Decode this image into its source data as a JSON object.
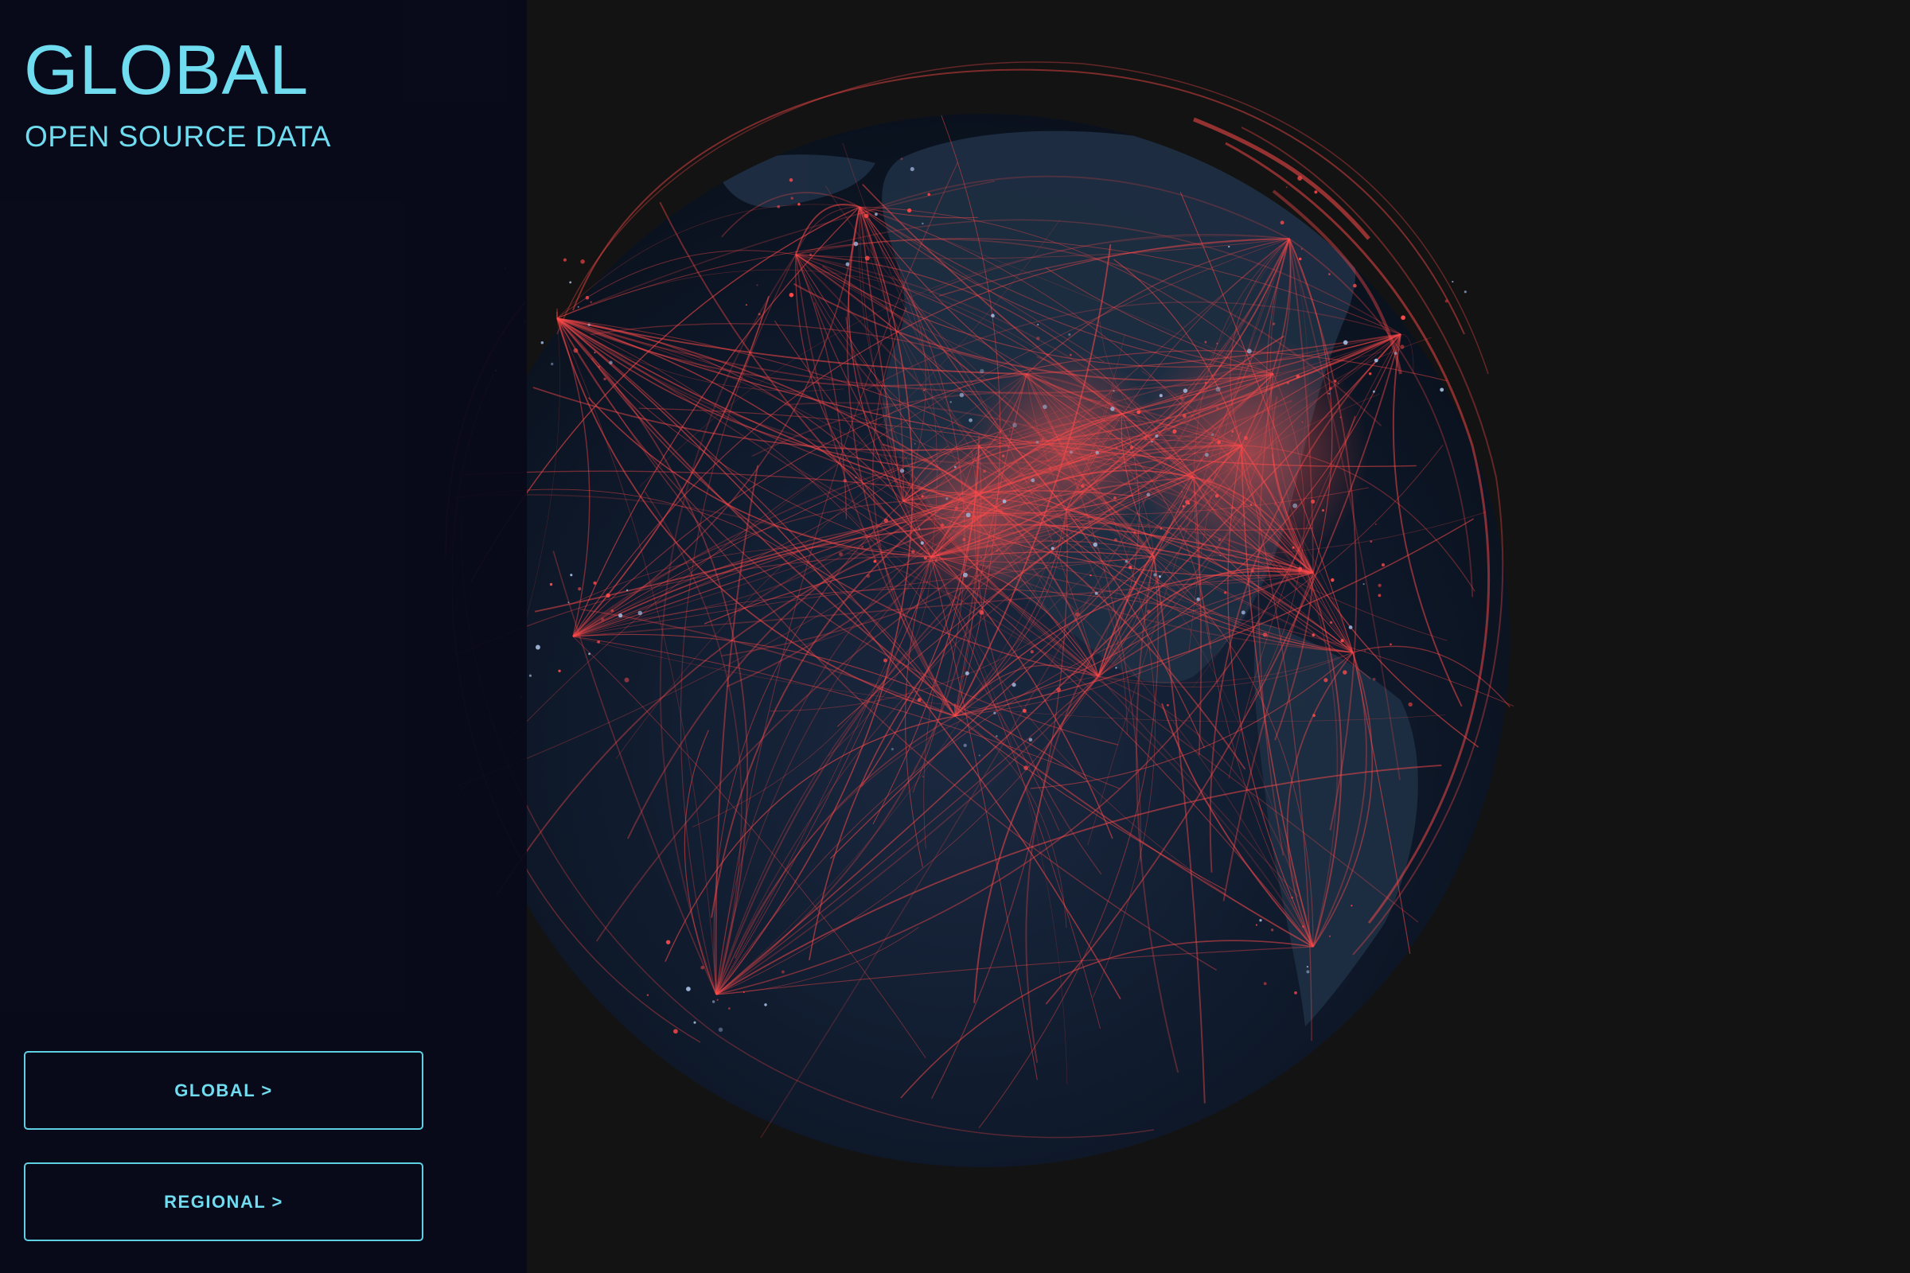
{
  "app": {
    "title": "GLOBAL",
    "subtitle": "OPEN SOURCE DATA"
  },
  "nav": {
    "global_label": "GLOBAL >",
    "regional_label": "REGIONAL >"
  },
  "colors": {
    "background": "#131313",
    "sidebar": "#080a1a",
    "accent": "#6fdcf0",
    "route_line": "#ff4a4a",
    "globe": "#0c1624"
  }
}
